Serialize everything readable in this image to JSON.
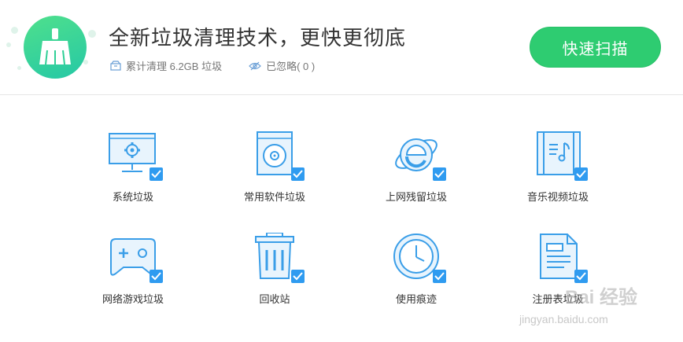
{
  "header": {
    "title": "全新垃圾清理技术，更快更彻底",
    "stats": {
      "cleaned_label": "累计清理 6.2GB 垃圾",
      "ignored_label": "已忽略( 0 )"
    },
    "scan_button": "快速扫描",
    "logo_icon": "broom-icon"
  },
  "categories": [
    {
      "label": "系统垃圾",
      "icon": "monitor-gear-icon",
      "checked": true
    },
    {
      "label": "常用软件垃圾",
      "icon": "software-disc-icon",
      "checked": true
    },
    {
      "label": "上网残留垃圾",
      "icon": "ie-browser-icon",
      "checked": true
    },
    {
      "label": "音乐视频垃圾",
      "icon": "music-file-icon",
      "checked": true
    },
    {
      "label": "网络游戏垃圾",
      "icon": "gamepad-icon",
      "checked": true
    },
    {
      "label": "回收站",
      "icon": "trash-bin-icon",
      "checked": true
    },
    {
      "label": "使用痕迹",
      "icon": "clock-icon",
      "checked": true
    },
    {
      "label": "注册表垃圾",
      "icon": "registry-document-icon",
      "checked": true
    }
  ],
  "watermark": {
    "text": "Bai 经验",
    "url_text": "jingyan.baidu.com"
  },
  "colors": {
    "accent_green": "#2ecc71",
    "icon_blue": "#3a9ee8",
    "check_blue": "#2f9bf0"
  }
}
